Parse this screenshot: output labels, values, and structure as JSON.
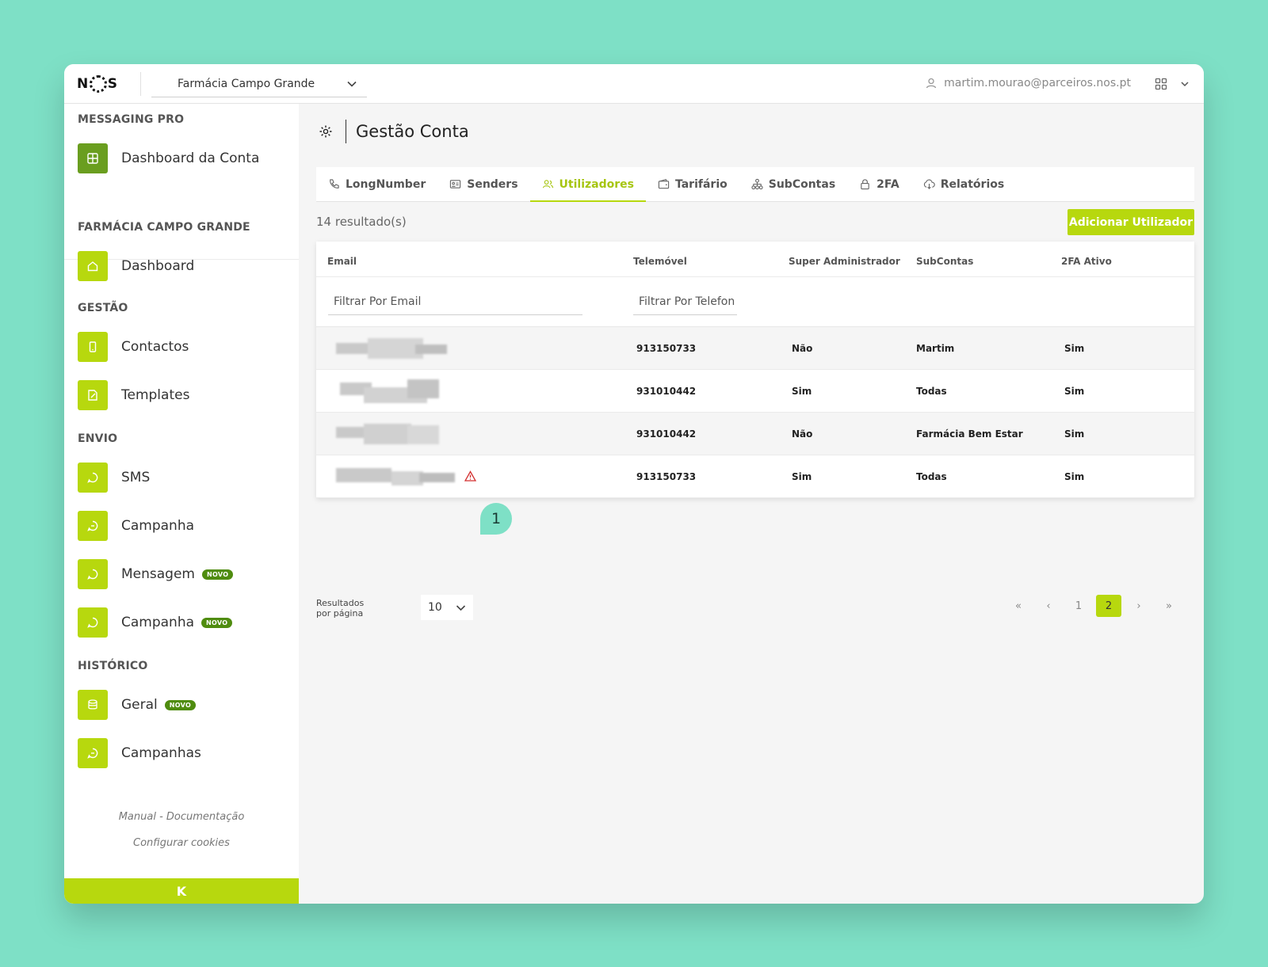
{
  "brand": {
    "logo_left": "N",
    "logo_right": "S",
    "accent": "#b7d80e",
    "badge_color": "#4f8c0f"
  },
  "header": {
    "account": "Farmácia Campo Grande",
    "user_email": "martim.mourao@parceiros.nos.pt"
  },
  "sidebar": {
    "sections": {
      "messaging": "MESSAGING PRO",
      "account": "FARMÁCIA CAMPO GRANDE",
      "gestao": "GESTÃO",
      "envio": "ENVIO",
      "historico": "HISTÓRICO"
    },
    "items": {
      "dashboard_conta": "Dashboard da Conta",
      "dashboard": "Dashboard",
      "contactos": "Contactos",
      "templates": "Templates",
      "sms": "SMS",
      "campanha": "Campanha",
      "mensagem": "Mensagem",
      "campanha_novo": "Campanha",
      "geral": "Geral",
      "campanhas": "Campanhas"
    },
    "badge": "NOVO",
    "footer": {
      "manual": "Manual - Documentação",
      "cookies": "Configurar cookies",
      "collapse": "K"
    }
  },
  "page": {
    "title": "Gestão Conta",
    "tabs": [
      "LongNumber",
      "Senders",
      "Utilizadores",
      "Tarifário",
      "SubContas",
      "2FA",
      "Relatórios"
    ],
    "active_tab": "Utilizadores",
    "results": "14 resultado(s)",
    "add_button": "Adicionar Utilizador"
  },
  "table": {
    "columns": {
      "email": "Email",
      "phone": "Telemóvel",
      "super_admin": "Super Administrador",
      "subaccounts": "SubContas",
      "twofa": "2FA Ativo"
    },
    "filters": {
      "email_placeholder": "Filtrar Por Email",
      "phone_placeholder": "Filtrar Por Telefon"
    },
    "rows": [
      {
        "phone": "913150733",
        "super_admin": "Não",
        "subaccounts": "Martim",
        "twofa": "Sim"
      },
      {
        "phone": "931010442",
        "super_admin": "Sim",
        "subaccounts": "Todas",
        "twofa": "Sim"
      },
      {
        "phone": "931010442",
        "super_admin": "Não",
        "subaccounts": "Farmácia Bem Estar",
        "twofa": "Sim"
      },
      {
        "phone": "913150733",
        "super_admin": "Sim",
        "subaccounts": "Todas",
        "twofa": "Sim"
      }
    ]
  },
  "annotation": {
    "marker": "1"
  },
  "pagination": {
    "per_page_label_1": "Resultados",
    "per_page_label_2": "por página",
    "per_page_value": "10",
    "first": "«",
    "prev": "‹",
    "pages": [
      "1",
      "2"
    ],
    "current": "2",
    "next": "›",
    "last": "»"
  }
}
